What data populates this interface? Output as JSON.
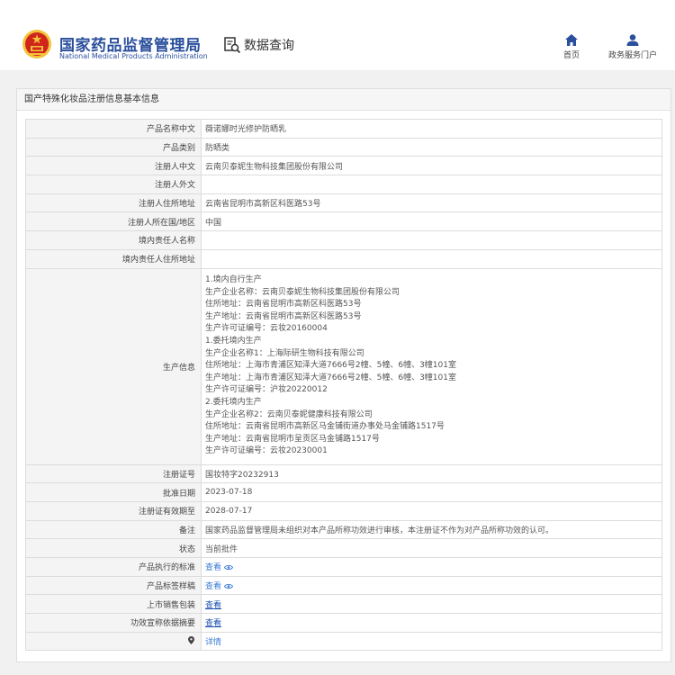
{
  "header": {
    "brand_cn": "国家药品监督管理局",
    "brand_en": "National Medical Products Administration",
    "query_label": "数据查询",
    "nav": [
      {
        "label": "首页",
        "icon": "home-icon"
      },
      {
        "label": "政务服务门户",
        "icon": "user-icon"
      }
    ]
  },
  "panel": {
    "title": "国产特殊化妆品注册信息基本信息"
  },
  "fields": {
    "product_name_cn": {
      "label": "产品名称中文",
      "value": "薇诺娜时光修护防晒乳"
    },
    "product_category": {
      "label": "产品类别",
      "value": "防晒类"
    },
    "registrant_cn": {
      "label": "注册人中文",
      "value": "云南贝泰妮生物科技集团股份有限公司"
    },
    "registrant_foreign": {
      "label": "注册人外文",
      "value": ""
    },
    "registrant_address": {
      "label": "注册人住所地址",
      "value": "云南省昆明市高新区科医路53号"
    },
    "registrant_region": {
      "label": "注册人所在国/地区",
      "value": "中国"
    },
    "domestic_rep_name": {
      "label": "境内责任人名称",
      "value": ""
    },
    "domestic_rep_address": {
      "label": "境内责任人住所地址",
      "value": ""
    },
    "production_info": {
      "label": "生产信息",
      "lines": [
        "1.境内自行生产",
        "生产企业名称：云南贝泰妮生物科技集团股份有限公司",
        "住所地址：云南省昆明市高新区科医路53号",
        "生产地址：云南省昆明市高新区科医路53号",
        "生产许可证编号：云妆20160004",
        "1.委托境内生产",
        "生产企业名称1：上海际研生物科技有限公司",
        "住所地址：上海市青浦区知泽大道7666号2幢、5幢、6幢、3幢101室",
        "生产地址：上海市青浦区知泽大道7666号2幢、5幢、6幢、3幢101室",
        "生产许可证编号：沪妆20220012",
        "2.委托境内生产",
        "生产企业名称2：云南贝泰妮健康科技有限公司",
        "住所地址：云南省昆明市高新区马金铺街道办事处马金铺路1517号",
        "生产地址：云南省昆明市呈贡区马金铺路1517号",
        "生产许可证编号：云妆20230001"
      ]
    },
    "reg_number": {
      "label": "注册证号",
      "value": "国妆特字20232913"
    },
    "approval_date": {
      "label": "批准日期",
      "value": "2023-07-18"
    },
    "valid_until": {
      "label": "注册证有效期至",
      "value": "2028-07-17"
    },
    "remark": {
      "label": "备注",
      "value": "国家药品监督管理局未组织对本产品所称功效进行审核，本注册证不作为对产品所称功效的认可。"
    },
    "status": {
      "label": "状态",
      "value": "当前批件"
    },
    "standard": {
      "label": "产品执行的标准",
      "link": "查看"
    },
    "label_sample": {
      "label": "产品标签样稿",
      "link": "查看"
    },
    "packaging": {
      "label": "上市销售包装",
      "link": "查看"
    },
    "efficacy_summary": {
      "label": "功效宣称依据摘要",
      "link": "查看"
    },
    "details": {
      "label": "",
      "link": "详情"
    }
  },
  "colors": {
    "brand_blue": "#2a4f9c",
    "link_blue": "#3a7bd5",
    "emblem_red": "#d0251c",
    "emblem_gold": "#f3c33b"
  }
}
